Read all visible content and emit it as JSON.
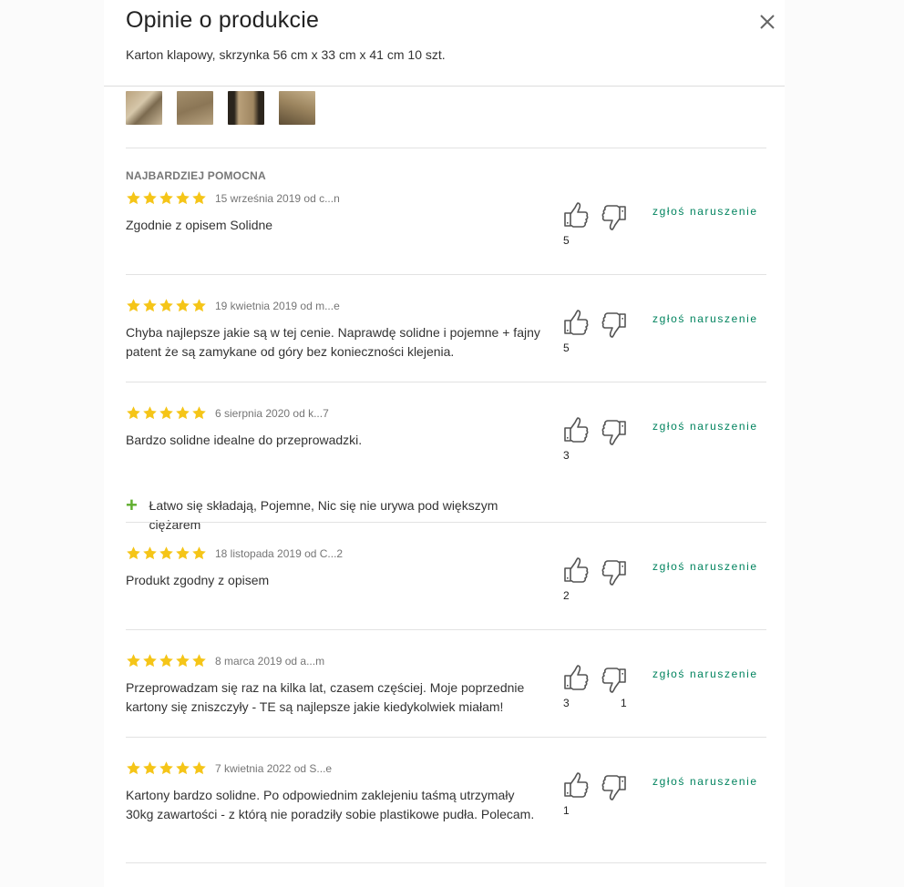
{
  "title": "Opinie o produkcie",
  "subtitle": "Karton klapowy, skrzynka 56 cm x 33 cm x 41 cm 10 szt.",
  "thumbnails": [
    "cardbox-photo-1",
    "cardbox-photo-2",
    "cardbox-photo-3",
    "cardbox-photo-4"
  ],
  "section_label": "NAJBARDZIEJ POMOCNA",
  "colors": {
    "star": "#f5c518",
    "report_link": "#00835e",
    "plus": "#5fae2e"
  },
  "report_label": "zgłoś naruszenie",
  "reviews": [
    {
      "rating": 5,
      "meta": "15 września 2019 od c...n",
      "text": "Zgodnie z opisem Solidne",
      "pros": "",
      "up": "5",
      "down": ""
    },
    {
      "rating": 5,
      "meta": "19 kwietnia 2019 od m...e",
      "text": "Chyba najlepsze jakie są w tej cenie. Naprawdę solidne i pojemne + fajny patent że są zamykane od góry bez konieczności klejenia.",
      "pros": "",
      "up": "5",
      "down": ""
    },
    {
      "rating": 5,
      "meta": "6 sierpnia 2020 od k...7",
      "text": "Bardzo solidne idealne do przeprowadzki.",
      "pros": "Łatwo się składają, Pojemne, Nic się nie urywa pod większym ciężarem",
      "up": "3",
      "down": ""
    },
    {
      "rating": 5,
      "meta": "18 listopada 2019 od C...2",
      "text": "Produkt zgodny z opisem",
      "pros": "",
      "up": "2",
      "down": ""
    },
    {
      "rating": 5,
      "meta": "8 marca 2019 od a...m",
      "text": "Przeprowadzam się raz na kilka lat, czasem częściej. Moje poprzednie kartony się zniszczyły - TE są najlepsze jakie kiedykolwiek miałam!",
      "pros": "",
      "up": "3",
      "down": "1"
    },
    {
      "rating": 5,
      "meta": "7 kwietnia 2022 od S...e",
      "text": "Kartony bardzo solidne. Po odpowiednim zaklejeniu taśmą utrzymały 30kg zawartości - z którą nie poradziły sobie plastikowe pudła. Polecam.",
      "pros": "",
      "up": "1",
      "down": ""
    }
  ]
}
